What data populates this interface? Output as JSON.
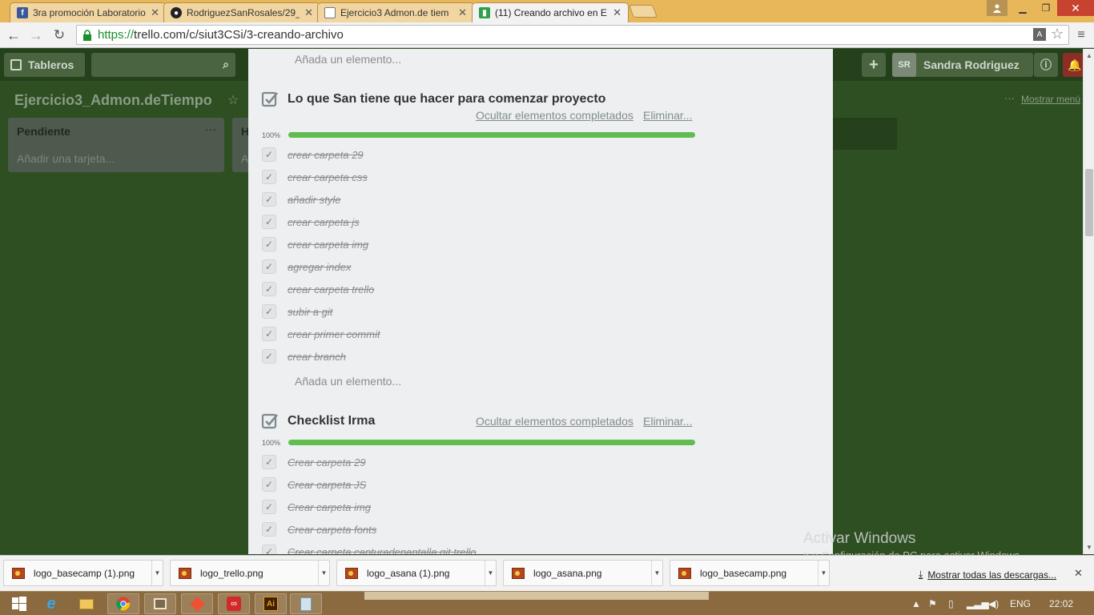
{
  "browser": {
    "tabs": [
      {
        "title": "3ra promoción Laboratorio",
        "icon": "facebook-icon",
        "active": false
      },
      {
        "title": "RodriguezSanRosales/29_",
        "icon": "github-icon",
        "active": false
      },
      {
        "title": "Ejercicio3 Admon.de tiem",
        "icon": "document-icon",
        "active": false
      },
      {
        "title": "(11) Creando archivo en E",
        "icon": "trello-icon",
        "active": true
      }
    ],
    "url_scheme": "https://",
    "url_rest": "trello.com/c/siut3CSi/3-creando-archivo"
  },
  "trello": {
    "boards_label": "Tableros",
    "user_initials": "SR",
    "user_name": "Sandra Rodriguez",
    "board_title": "Ejercicio3_Admon.deTiempo",
    "show_menu": "Mostrar menú",
    "lists": [
      {
        "title": "Pendiente",
        "add_card": "Añadir una tarjeta..."
      },
      {
        "title": "H",
        "add_card": "A"
      }
    ]
  },
  "card": {
    "add_item_label": "Añada un elemento...",
    "hide_completed": "Ocultar elementos completados",
    "delete": "Eliminar...",
    "checklists": [
      {
        "title": "Lo que San tiene que hacer para comenzar proyecto",
        "progress": "100%",
        "items": [
          "crear carpeta 29",
          "crear carpeta css",
          "añadir style",
          "crear carpeta js",
          "crear carpeta img",
          "agregar index",
          "crear carpeta trello",
          "subir a git",
          "crear primer commit",
          "crear branch"
        ]
      },
      {
        "title": "Checklist Irma",
        "progress": "100%",
        "items": [
          "Crear carpeta 29",
          "Crear carpeta JS",
          "Crear carpeta img",
          "Crear carpeta fonts",
          "Crear carpeta capturadepantalla.git.trello"
        ]
      }
    ]
  },
  "windows": {
    "activate_title": "Activar Windows",
    "activate_sub": "Ir a Configuración de PC para activar Windows.",
    "language": "ENG",
    "time": "22:02"
  },
  "downloads": {
    "files": [
      "logo_basecamp (1).png",
      "logo_trello.png",
      "logo_asana (1).png",
      "logo_asana.png",
      "logo_basecamp.png"
    ],
    "show_all": "Mostrar todas las descargas..."
  },
  "colors": {
    "board_bg": "#2d4f22",
    "progress_green": "#61bd4f",
    "tab_strip": "#e8b75a"
  }
}
